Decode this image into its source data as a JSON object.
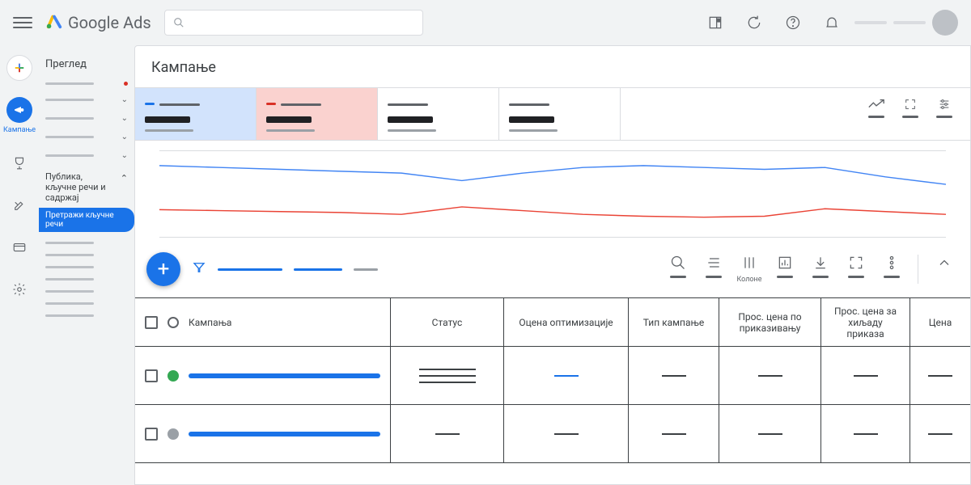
{
  "app_name": "Google Ads",
  "nav": {
    "overview": "Преглед",
    "campaigns_label": "Кампање",
    "section_audience": "Публика, кључне речи и садржај",
    "pill_search_keywords": "Претражи кључне речи"
  },
  "page": {
    "title": "Кампање"
  },
  "toolbar": {
    "columns_label": "Колоне"
  },
  "table": {
    "headers": {
      "campaign": "Кампања",
      "status": "Статус",
      "opt_score": "Оцена оптимизације",
      "campaign_type": "Тип кампање",
      "avg_cpv": "Прос. цена по приказивању",
      "avg_cpm": "Прос. цена за хиљаду приказа",
      "price": "Цена"
    },
    "rows": [
      {
        "status_color": "#34a853"
      },
      {
        "status_color": "#9aa0a6"
      }
    ]
  },
  "chart_data": {
    "type": "line",
    "x": [
      0,
      1,
      2,
      3,
      4,
      5,
      6,
      7,
      8,
      9,
      10,
      11,
      12,
      13
    ],
    "series": [
      {
        "name": "red",
        "color": "#ea4335",
        "values": [
          35,
          34,
          33,
          32,
          30,
          38,
          34,
          30,
          28,
          27,
          28,
          36,
          33,
          30
        ]
      },
      {
        "name": "blue",
        "color": "#4285f4",
        "values": [
          82,
          80,
          78,
          76,
          74,
          66,
          74,
          80,
          82,
          80,
          78,
          80,
          70,
          62
        ]
      }
    ],
    "ylim": [
      0,
      100
    ]
  }
}
